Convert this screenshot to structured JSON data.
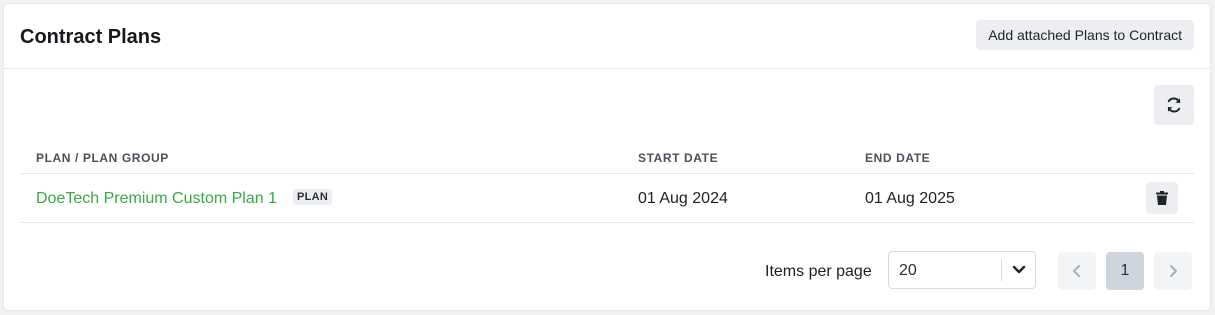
{
  "header": {
    "title": "Contract Plans",
    "add_button_label": "Add attached Plans to Contract"
  },
  "table": {
    "columns": [
      "PLAN / PLAN GROUP",
      "START DATE",
      "END DATE"
    ],
    "rows": [
      {
        "plan_name": "DoeTech Premium Custom Plan 1",
        "badge": "PLAN",
        "start_date": "01 Aug 2024",
        "end_date": "01 Aug 2025"
      }
    ]
  },
  "pagination": {
    "items_per_page_label": "Items per page",
    "items_per_page_value": "20",
    "current_page": "1"
  },
  "icons": {
    "refresh": "refresh-icon",
    "delete": "trash-icon",
    "select_arrow": "chevron-down-icon",
    "prev": "chevron-left-icon",
    "next": "chevron-right-icon"
  },
  "colors": {
    "link": "#3aa845",
    "button_bg": "#eceef1",
    "current_page_bg": "#cfd5de"
  }
}
